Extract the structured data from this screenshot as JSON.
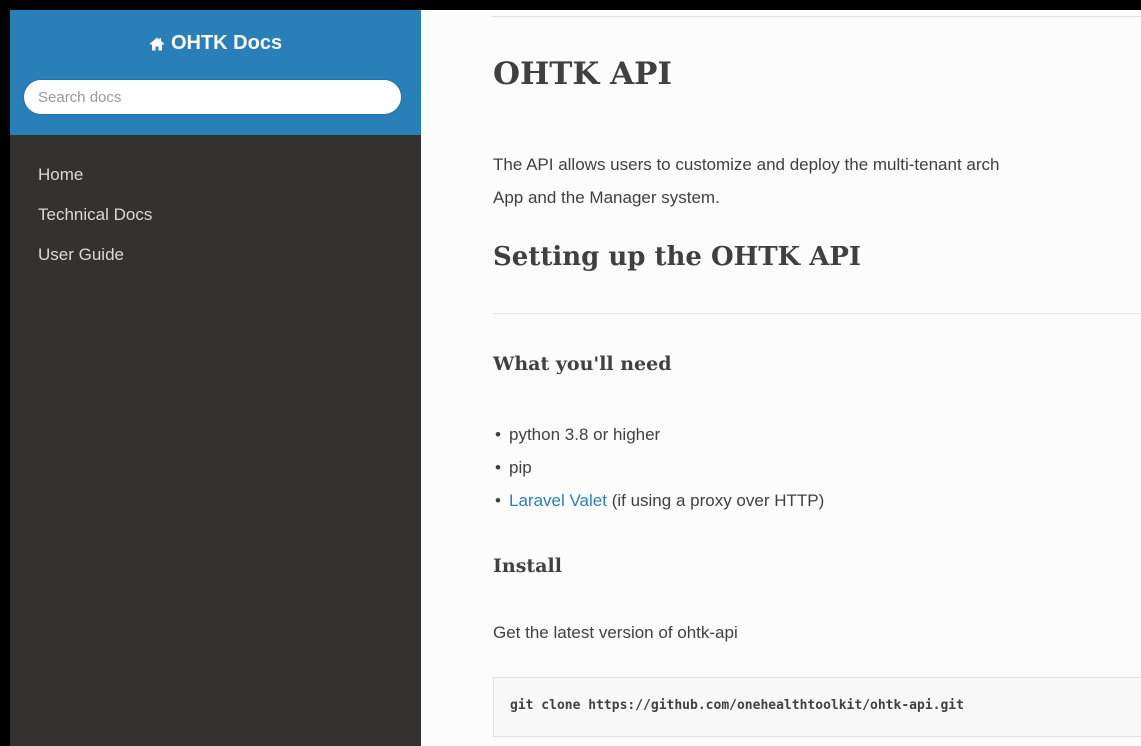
{
  "sidebar": {
    "brand": "OHTK Docs",
    "search_placeholder": "Search docs",
    "nav": [
      {
        "label": "Home"
      },
      {
        "label": "Technical Docs"
      },
      {
        "label": "User Guide"
      }
    ]
  },
  "main": {
    "title": "OHTK API",
    "intro_line1": "The API allows users to customize and deploy the multi-tenant arch",
    "intro_line2": "App and the Manager system.",
    "section_title": "Setting up the OHTK API",
    "requirements_heading": "What you'll need",
    "requirements": {
      "item1": "python 3.8 or higher",
      "item2": "pip",
      "item3_link": "Laravel Valet",
      "item3_rest": " (if using a proxy over HTTP)"
    },
    "install_heading": "Install",
    "install_text": "Get the latest version of ohtk-api",
    "install_code": "git clone https://github.com/onehealthtoolkit/ohtk-api.git"
  },
  "colors": {
    "sidebar_header": "#2980b9",
    "sidebar_body": "#343131",
    "link": "#2980b9",
    "text": "#404040"
  },
  "icons": {
    "brand": "home-icon"
  }
}
